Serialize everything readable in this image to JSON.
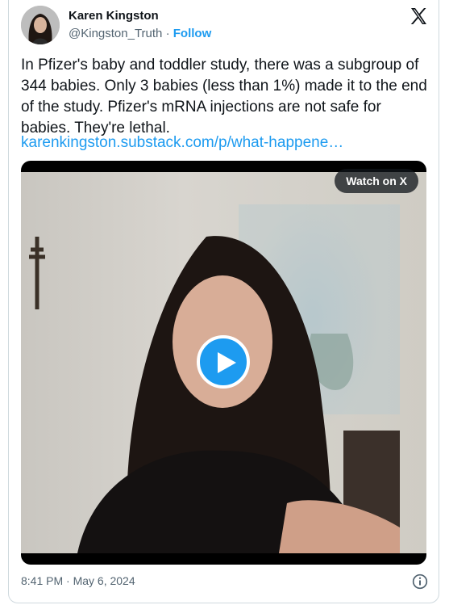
{
  "author": {
    "name": "Karen Kingston",
    "handle": "@Kingston_Truth",
    "separator": "·",
    "follow_label": "Follow"
  },
  "tweet": {
    "text": "In Pfizer's baby and toddler study, there was a subgroup of 344 babies. Only 3 babies (less than 1%) made it to the end of the study. Pfizer's mRNA injections are not safe for babies. They're lethal.",
    "link": "karenkingston.substack.com/p/what-happene…"
  },
  "video": {
    "watch_label": "Watch on X"
  },
  "footer": {
    "timestamp": "8:41 PM · May 6, 2024"
  },
  "icons": {
    "brand": "x-logo-icon",
    "play": "play-icon",
    "info": "info-icon"
  },
  "colors": {
    "accent": "#1d9bf0",
    "text": "#0f1419",
    "muted": "#536471"
  }
}
